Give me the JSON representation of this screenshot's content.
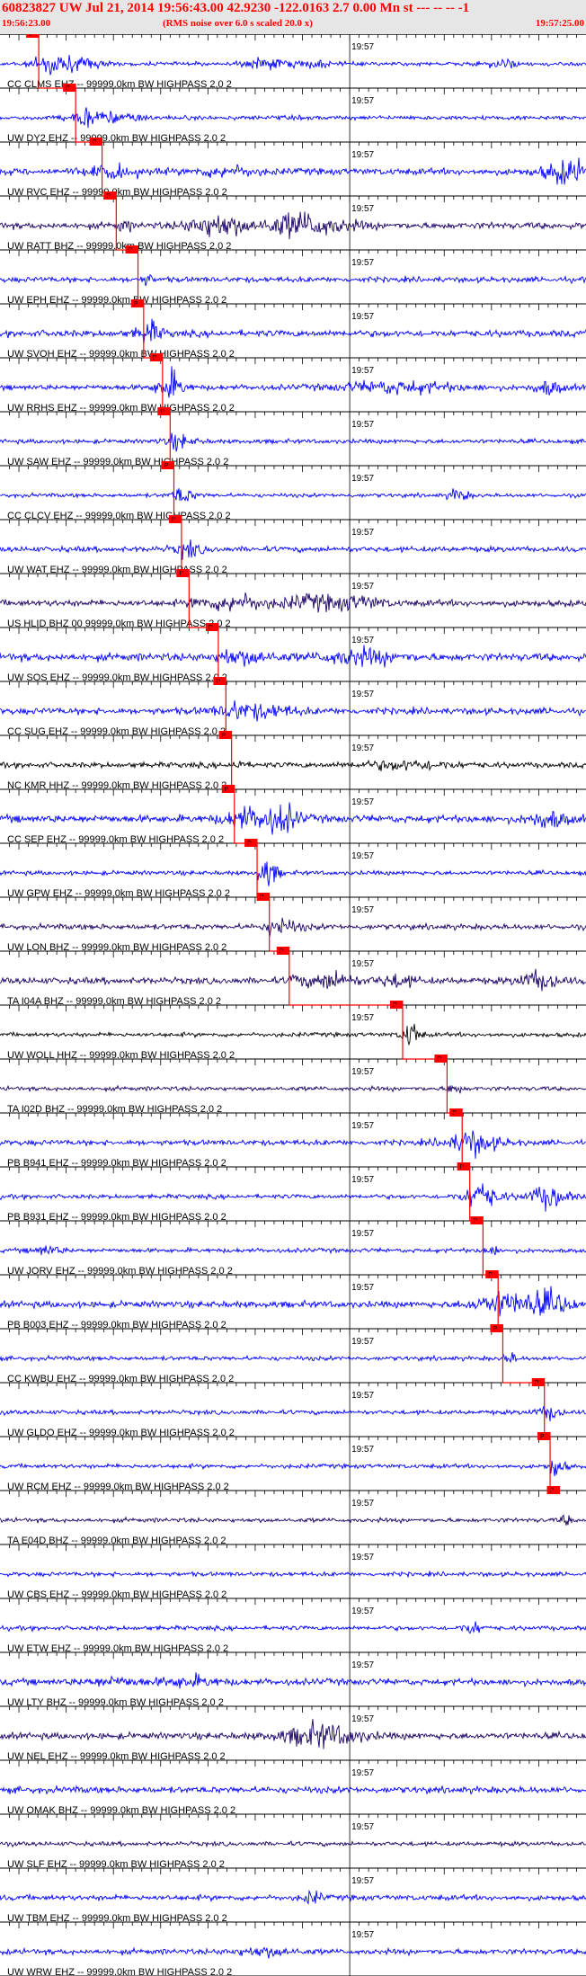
{
  "header": {
    "title": "60823827 UW Jul 21, 2014 19:56:43.00    42.9230 -122.0163  2.7 0.00 Mn st --- -- --   -1",
    "start_time": "19:56:23.00",
    "note": "(RMS noise over 6.0 s scaled 20.0 x)",
    "end_time": "19:57:25.00"
  },
  "colors": {
    "trace_blue": "#0000ff",
    "trace_navy": "#1a0066",
    "trace_black": "#000000",
    "pick_red": "#ff0000",
    "header_bg": "#e6e6e6",
    "text_red": "#ff0000"
  },
  "chart_data": {
    "type": "seismogram",
    "minute_label": "19:57",
    "time_axis": {
      "start": "19:56:23.00",
      "end": "19:57:25.00",
      "minute_mark": "19:57:00",
      "duration_s": 62
    },
    "pick_label": "P",
    "stations": [
      {
        "label": "CC CLMS EHZ -- 99999.0km BW  HIGHPASS  2.0  2",
        "color": "blue",
        "pick_s": 4.1,
        "noise": 0.18,
        "bursts": [
          [
            5.5,
            0.7,
            4
          ],
          [
            8.5,
            0.4,
            5
          ],
          [
            28,
            0.5,
            4
          ],
          [
            33,
            0.3,
            4
          ],
          [
            53,
            0.4,
            3
          ]
        ]
      },
      {
        "label": "UW DY2 EHZ -- 99999.0km BW  HIGHPASS  2.0  2",
        "color": "blue",
        "pick_s": 8.0,
        "noise": 0.2,
        "bursts": [
          [
            9.5,
            0.5,
            4
          ],
          [
            13,
            0.3,
            5
          ]
        ]
      },
      {
        "label": "UW RVC EHZ -- 99999.0km BW  HIGHPASS  2.0  2",
        "color": "blue",
        "pick_s": 10.8,
        "noise": 0.3,
        "bursts": [
          [
            12,
            0.4,
            6
          ],
          [
            24,
            0.4,
            6
          ],
          [
            60,
            1.0,
            5
          ]
        ]
      },
      {
        "label": "UW RATT BHZ -- 99999.0km BW  HIGHPASS  2.0  2",
        "color": "navy",
        "pick_s": 12.3,
        "noise": 0.3,
        "bursts": [
          [
            23,
            1.0,
            6
          ],
          [
            31,
            0.8,
            6
          ],
          [
            34,
            0.5,
            8
          ]
        ]
      },
      {
        "label": "UW EPH EHZ -- 99999.0km BW  HIGHPASS  2.0  2",
        "color": "blue",
        "pick_s": 14.6,
        "noise": 0.25,
        "bursts": []
      },
      {
        "label": "UW SVOH EHZ -- 99999.0km BW  HIGHPASS  2.0  2",
        "color": "blue",
        "pick_s": 15.2,
        "noise": 0.3,
        "bursts": [
          [
            15.8,
            0.6,
            3
          ]
        ]
      },
      {
        "label": "UW RRHS EHZ -- 99999.0km BW  HIGHPASS  2.0  2",
        "color": "blue",
        "pick_s": 17.2,
        "noise": 0.25,
        "bursts": [
          [
            18,
            1.0,
            3
          ],
          [
            42,
            0.5,
            12
          ],
          [
            58,
            0.6,
            3
          ]
        ]
      },
      {
        "label": "UW SAW EHZ -- 99999.0km BW  HIGHPASS  2.0  2",
        "color": "blue",
        "pick_s": 18.0,
        "noise": 0.2,
        "bursts": [
          [
            19,
            0.3,
            4
          ]
        ]
      },
      {
        "label": "CC CLCV EHZ -- 99999.0km BW  HIGHPASS  2.0  2",
        "color": "blue",
        "pick_s": 18.4,
        "noise": 0.18,
        "bursts": [
          [
            19.5,
            0.4,
            3
          ],
          [
            48.5,
            0.6,
            2
          ]
        ]
      },
      {
        "label": "UW WAT EHZ -- 99999.0km BW  HIGHPASS  2.0  2",
        "color": "blue",
        "pick_s": 19.2,
        "noise": 0.25,
        "bursts": [
          [
            20,
            0.3,
            4
          ]
        ]
      },
      {
        "label": "US HLID BHZ 00 99999.0km BW  HIGHPASS  2.0  2",
        "color": "navy",
        "pick_s": 20.0,
        "noise": 0.3,
        "bursts": [
          [
            25,
            0.7,
            6
          ],
          [
            33,
            0.6,
            6
          ],
          [
            38,
            0.5,
            5
          ]
        ]
      },
      {
        "label": "UW SOS EHZ -- 99999.0km BW  HIGHPASS  2.0  2",
        "color": "blue",
        "pick_s": 23.1,
        "noise": 0.35,
        "bursts": [
          [
            26,
            0.5,
            6
          ],
          [
            38,
            0.6,
            8
          ]
        ]
      },
      {
        "label": "CC SUG EHZ -- 99999.0km BW  HIGHPASS  2.0  2",
        "color": "blue",
        "pick_s": 23.9,
        "noise": 0.3,
        "bursts": [
          [
            27,
            0.6,
            8
          ]
        ]
      },
      {
        "label": "NC KMR HHZ -- 99999.0km BW  HIGHPASS  2.0  2",
        "color": "black",
        "pick_s": 24.5,
        "noise": 0.25,
        "bursts": [
          [
            43,
            0.35,
            10
          ]
        ]
      },
      {
        "label": "CC SEP EHZ -- 99999.0km BW  HIGHPASS  2.0  2",
        "color": "blue",
        "pick_s": 24.8,
        "noise": 0.35,
        "bursts": [
          [
            27,
            0.8,
            6
          ],
          [
            30,
            1.0,
            3
          ],
          [
            58,
            0.7,
            4
          ]
        ]
      },
      {
        "label": "UW GPW EHZ -- 99999.0km BW  HIGHPASS  2.0  2",
        "color": "blue",
        "pick_s": 27.2,
        "noise": 0.2,
        "bursts": [
          [
            28.5,
            1.0,
            2
          ]
        ]
      },
      {
        "label": "UW LON BHZ -- 99999.0km BW  HIGHPASS  2.0  2",
        "color": "navy",
        "pick_s": 28.5,
        "noise": 0.25,
        "bursts": [
          [
            30,
            0.5,
            4
          ]
        ]
      },
      {
        "label": "TA I04A BHZ -- 99999.0km BW  HIGHPASS  2.0  2",
        "color": "navy",
        "pick_s": 30.6,
        "noise": 0.3,
        "bursts": [
          [
            35,
            0.7,
            5
          ],
          [
            42,
            0.5,
            4
          ],
          [
            57,
            0.8,
            4
          ]
        ]
      },
      {
        "label": "UW WOLL HHZ -- 99999.0km BW  HIGHPASS  2.0  2",
        "color": "black",
        "pick_s": 42.6,
        "noise": 0.2,
        "bursts": [
          [
            43.5,
            0.8,
            2
          ]
        ]
      },
      {
        "label": "TA I02D BHZ -- 99999.0km BW  HIGHPASS  2.0  2",
        "color": "navy",
        "pick_s": 47.3,
        "noise": 0.2,
        "bursts": []
      },
      {
        "label": "PB B941 EHZ -- 99999.0km BW  HIGHPASS  2.0  2",
        "color": "blue",
        "pick_s": 48.9,
        "noise": 0.25,
        "bursts": [
          [
            50,
            0.8,
            6
          ]
        ]
      },
      {
        "label": "PB B931 EHZ -- 99999.0km BW  HIGHPASS  2.0  2",
        "color": "blue",
        "pick_s": 49.7,
        "noise": 0.2,
        "bursts": [
          [
            51,
            1.0,
            4
          ],
          [
            58,
            1.0,
            4
          ]
        ]
      },
      {
        "label": "UW JORV EHZ -- 99999.0km BW  HIGHPASS  2.0  2",
        "color": "blue",
        "pick_s": 51.1,
        "noise": 0.2,
        "bursts": [
          [
            5,
            0.4,
            3
          ]
        ]
      },
      {
        "label": "PB B003 EHZ -- 99999.0km BW  HIGHPASS  2.0  2",
        "color": "blue",
        "pick_s": 52.7,
        "noise": 0.3,
        "bursts": [
          [
            53,
            0.8,
            6
          ],
          [
            58,
            1.0,
            5
          ]
        ]
      },
      {
        "label": "CC KWBU EHZ -- 99999.0km BW  HIGHPASS  2.0  2",
        "color": "blue",
        "pick_s": 53.2,
        "noise": 0.2,
        "bursts": []
      },
      {
        "label": "UW GLDO EHZ -- 99999.0km BW  HIGHPASS  2.0  2",
        "color": "blue",
        "pick_s": 57.6,
        "noise": 0.2,
        "bursts": [
          [
            58,
            0.4,
            3
          ]
        ]
      },
      {
        "label": "UW RCM EHZ -- 99999.0km BW  HIGHPASS  2.0  2",
        "color": "blue",
        "pick_s": 58.2,
        "noise": 0.2,
        "bursts": [
          [
            59,
            0.5,
            2
          ]
        ]
      },
      {
        "label": "TA E04D BHZ -- 99999.0km BW  HIGHPASS  2.0  2",
        "color": "navy",
        "pick_s": 59.2,
        "noise": 0.2,
        "bursts": []
      },
      {
        "label": "UW CBS EHZ -- 99999.0km BW  HIGHPASS  2.0  2",
        "color": "blue",
        "pick_s": null,
        "noise": 0.2,
        "bursts": []
      },
      {
        "label": "UW ETW EHZ -- 99999.0km BW  HIGHPASS  2.0  2",
        "color": "blue",
        "pick_s": null,
        "noise": 0.2,
        "bursts": [
          [
            50,
            0.6,
            2
          ]
        ]
      },
      {
        "label": "UW LTY BHZ -- 99999.0km BW  HIGHPASS  2.0  2",
        "color": "blue",
        "pick_s": null,
        "noise": 0.3,
        "bursts": [
          [
            12,
            0.3,
            6
          ],
          [
            20,
            0.4,
            6
          ]
        ]
      },
      {
        "label": "UW NEL EHZ -- 99999.0km BW  HIGHPASS  2.0  2",
        "color": "navy",
        "pick_s": null,
        "noise": 0.3,
        "bursts": [
          [
            34,
            1.0,
            8
          ]
        ]
      },
      {
        "label": "UW OMAK BHZ -- 99999.0km BW  HIGHPASS  2.0  2",
        "color": "blue",
        "pick_s": null,
        "noise": 0.3,
        "bursts": []
      },
      {
        "label": "UW SLF EHZ -- 99999.0km BW  HIGHPASS  2.0  2",
        "color": "navy",
        "pick_s": null,
        "noise": 0.2,
        "bursts": []
      },
      {
        "label": "UW TBM EHZ -- 99999.0km BW  HIGHPASS  2.0  2",
        "color": "blue",
        "pick_s": null,
        "noise": 0.25,
        "bursts": [
          [
            33,
            0.5,
            2
          ]
        ]
      },
      {
        "label": "UW WRW EHZ -- 99999.0km BW  HIGHPASS  2.0  2",
        "color": "blue",
        "pick_s": null,
        "noise": 0.25,
        "bursts": [
          [
            28,
            0.35,
            6
          ]
        ]
      },
      {
        "label": "",
        "color": "blue",
        "pick_s": null,
        "noise": 0.25,
        "bursts": [
          [
            19,
            0.35,
            5
          ]
        ]
      }
    ]
  }
}
